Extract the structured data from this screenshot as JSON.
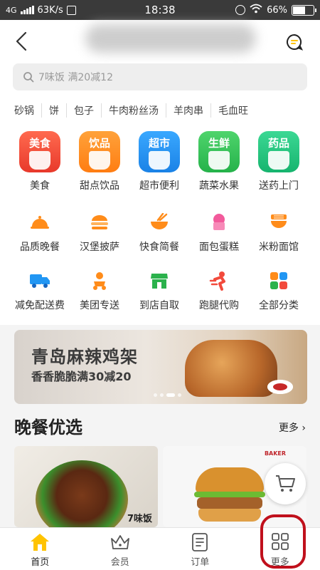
{
  "status_bar": {
    "network": "4G",
    "speed": "63K/s",
    "time": "18:38",
    "battery": "66%",
    "battery_level": 0.66
  },
  "search": {
    "placeholder": "7味饭 满20减12"
  },
  "hot_words": [
    "砂锅",
    "饼",
    "包子",
    "牛肉粉丝汤",
    "羊肉串",
    "毛血旺"
  ],
  "categories_row1": [
    {
      "label": "美食",
      "tag": "美食",
      "color": "#f24a3c",
      "icon": "cutlery-icon"
    },
    {
      "label": "甜点饮品",
      "tag": "饮品",
      "color": "#ff8a1f",
      "icon": "drink-cup-icon"
    },
    {
      "label": "超市便利",
      "tag": "超市",
      "color": "#2196f3",
      "icon": "basket-icon"
    },
    {
      "label": "蔬菜水果",
      "tag": "生鲜",
      "color": "#32c25a",
      "icon": "lime-icon"
    },
    {
      "label": "送药上门",
      "tag": "药品",
      "color": "#1fbf7a",
      "icon": "medkit-icon"
    }
  ],
  "categories_row2": [
    {
      "label": "品质晚餐",
      "icon": "cloche-icon",
      "color": "#ff8c1a"
    },
    {
      "label": "汉堡披萨",
      "icon": "burger-icon",
      "color": "#ff8c1a"
    },
    {
      "label": "快食简餐",
      "icon": "bowl-icon",
      "color": "#ff8c1a"
    },
    {
      "label": "面包蛋糕",
      "icon": "cake-icon",
      "color": "#f25a9b"
    },
    {
      "label": "米粉面馆",
      "icon": "noodles-icon",
      "color": "#ff8c1a"
    }
  ],
  "categories_row3": [
    {
      "label": "减免配送费",
      "icon": "truck-icon",
      "color": "#2196f3"
    },
    {
      "label": "美团专送",
      "icon": "scooter-icon",
      "color": "#ff8c1a"
    },
    {
      "label": "到店自取",
      "icon": "shop-icon",
      "color": "#2bb24c"
    },
    {
      "label": "跑腿代购",
      "icon": "runner-icon",
      "color": "#f24a3c"
    },
    {
      "label": "全部分类",
      "icon": "grid-icon",
      "color": "#ff8c1a"
    }
  ],
  "banner": {
    "title": "青岛麻辣鸡架",
    "subtitle": "香香脆脆满30减20"
  },
  "section": {
    "title": "晚餐优选",
    "more": "更多 ›"
  },
  "cards": [
    {
      "brand": "7味饭"
    },
    {
      "brand": "BAKER"
    }
  ],
  "tabs": [
    {
      "label": "首页",
      "icon": "home-icon",
      "active": true
    },
    {
      "label": "会员",
      "icon": "crown-icon",
      "active": false
    },
    {
      "label": "订单",
      "icon": "order-list-icon",
      "active": false
    },
    {
      "label": "更多",
      "icon": "more-grid-icon",
      "active": false
    }
  ],
  "colors": {
    "accent": "#ffc300",
    "highlight_ring": "#c0101c"
  }
}
